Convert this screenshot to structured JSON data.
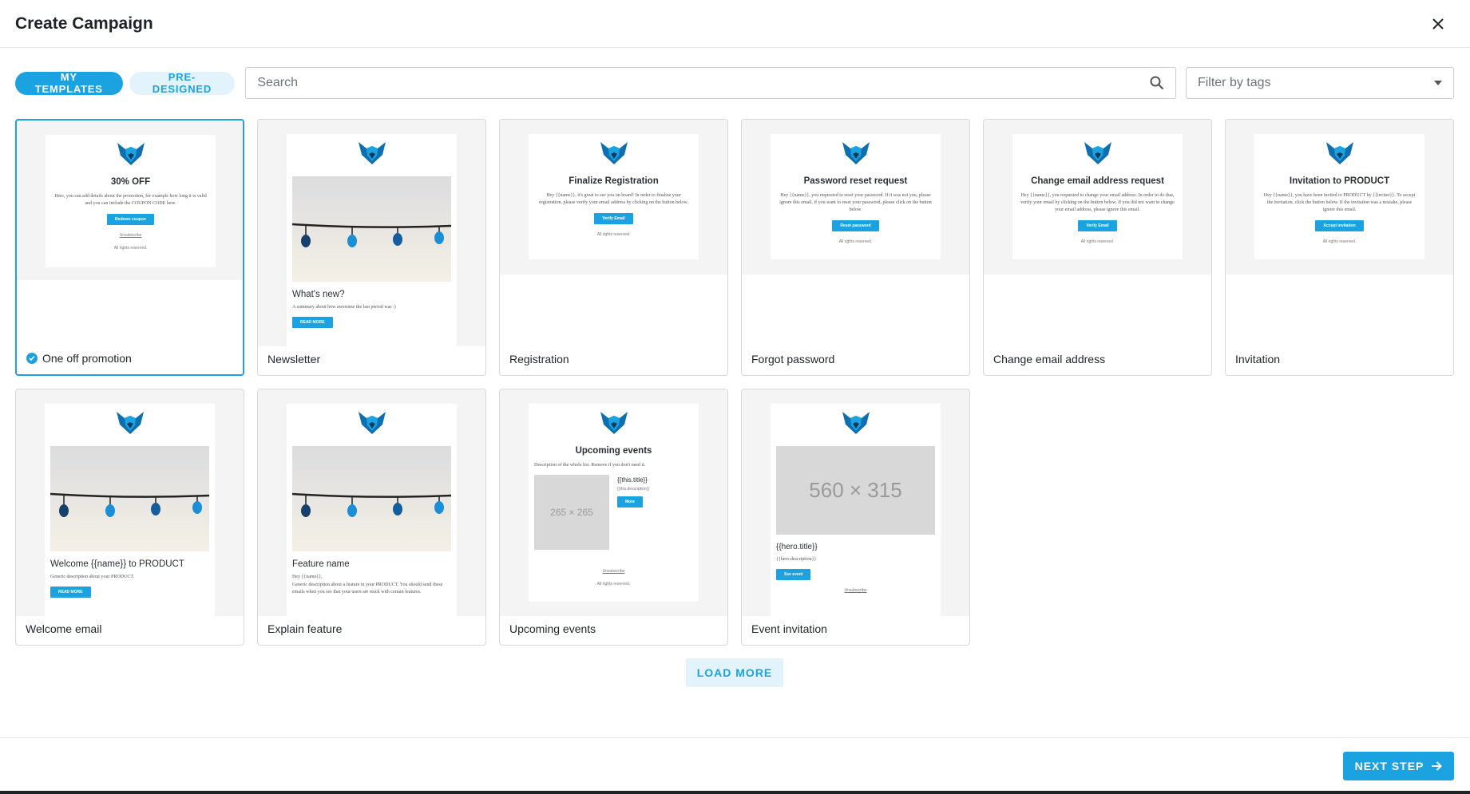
{
  "dialog": {
    "title": "Create Campaign"
  },
  "tabs": {
    "my_templates": "MY TEMPLATES",
    "pre_designed": "PRE-DESIGNED"
  },
  "search": {
    "placeholder": "Search"
  },
  "filter": {
    "placeholder": "Filter by tags"
  },
  "templates": [
    {
      "label": "One off promotion",
      "selected": true,
      "preview": {
        "title": "30% OFF",
        "body": "Here, you can add details about the promotion, for example how long it is valid and you can include the COUPON CODE here.",
        "button": "Redeem coupon",
        "link": "Unsubscribe",
        "footer": "All rights reserved."
      }
    },
    {
      "label": "Newsletter",
      "preview": {
        "title": "What's new?",
        "body": "A summary about how awesome the last period was :)",
        "button": "READ MORE"
      }
    },
    {
      "label": "Registration",
      "preview": {
        "title": "Finalize Registration",
        "body": "Hey {{name}}, it's great to see you on board! In order to finalize your registration, please verify your email address by clicking on the button below.",
        "button": "Verify Email",
        "footer": "All rights reserved."
      }
    },
    {
      "label": "Forgot password",
      "preview": {
        "title": "Password reset request",
        "body": "Hey {{name}}, you requested to reset your password. If it was not you, please ignore this email, if you want to reset your password, please click on the button below.",
        "button": "Reset password",
        "footer": "All rights reserved."
      }
    },
    {
      "label": "Change email address",
      "preview": {
        "title": "Change email address request",
        "body": "Hey {{name}}, you requested to change your email address. In order to do that, verify your email by clicking on the button below. If you did not want to change your email address, please ignore this email.",
        "button": "Verify Email",
        "footer": "All rights reserved."
      }
    },
    {
      "label": "Invitation",
      "preview": {
        "title": "Invitation to PRODUCT",
        "body": "Hey {{name}}, you have been invited to PRODUCT by {{inviter}}. To accept the invitation, click the button below. If the invitation was a mistake, please ignore this email.",
        "button": "Accept invitation",
        "footer": "All rights reserved."
      }
    },
    {
      "label": "Welcome email",
      "preview": {
        "title": "Welcome {{name}} to PRODUCT",
        "body": "Generic description about your PRODUCT.",
        "button": "READ MORE"
      }
    },
    {
      "label": "Explain feature",
      "preview": {
        "title": "Feature name",
        "body": "Hey {{name}},",
        "body2": "Generic description about a feature in your PRODUCT. You should send these emails when you see that your users are stuck with certain features."
      }
    },
    {
      "label": "Upcoming events",
      "preview": {
        "title": "Upcoming events",
        "body": "Description of the whole list. Remove if you don't need it.",
        "placeholder": "265 × 265",
        "item_title": "{{this.title}}",
        "item_desc": "{{this.description}}",
        "button": "More",
        "link": "Unsubscribe",
        "footer": "All rights reserved."
      }
    },
    {
      "label": "Event invitation",
      "preview": {
        "placeholder": "560 × 315",
        "title": "{{hero.title}}",
        "body": "{{hero.description}}",
        "button": "See event",
        "link": "Unsubscribe"
      }
    }
  ],
  "load_more": "LOAD MORE",
  "next_step": "NEXT STEP",
  "colors": {
    "accent": "#1aa3e0",
    "accent_light": "#e2f3fb"
  }
}
